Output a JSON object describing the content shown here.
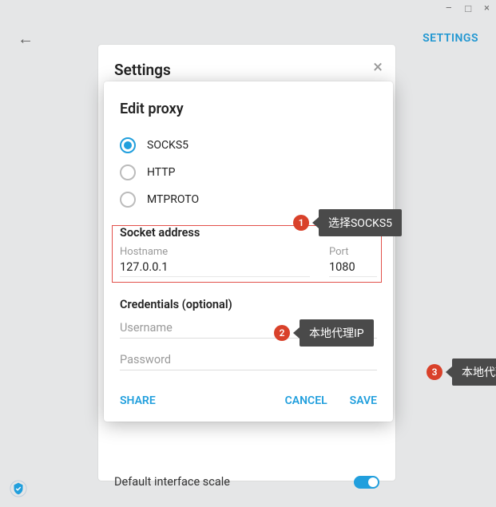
{
  "window": {
    "minimize": "–",
    "maximize": "□",
    "close": "×"
  },
  "topbar": {
    "back_glyph": "←",
    "settings_link": "SETTINGS"
  },
  "settings_panel": {
    "title": "Settings",
    "close_glyph": "×",
    "toggle_row_label": "Default interface scale"
  },
  "modal": {
    "title": "Edit proxy",
    "proxy_types": [
      {
        "label": "SOCKS5",
        "selected": true
      },
      {
        "label": "HTTP",
        "selected": false
      },
      {
        "label": "MTPROTO",
        "selected": false
      }
    ],
    "socket_address_title": "Socket address",
    "hostname_label": "Hostname",
    "hostname_value": "127.0.0.1",
    "port_label": "Port",
    "port_value": "1080",
    "credentials_title": "Credentials (optional)",
    "username_placeholder": "Username",
    "password_placeholder": "Password",
    "share_label": "SHARE",
    "cancel_label": "CANCEL",
    "save_label": "SAVE"
  },
  "annotations": [
    {
      "n": "1",
      "text": "选择SOCKS5"
    },
    {
      "n": "2",
      "text": "本地代理IP"
    },
    {
      "n": "3",
      "text": "本地代理默认端口"
    }
  ]
}
